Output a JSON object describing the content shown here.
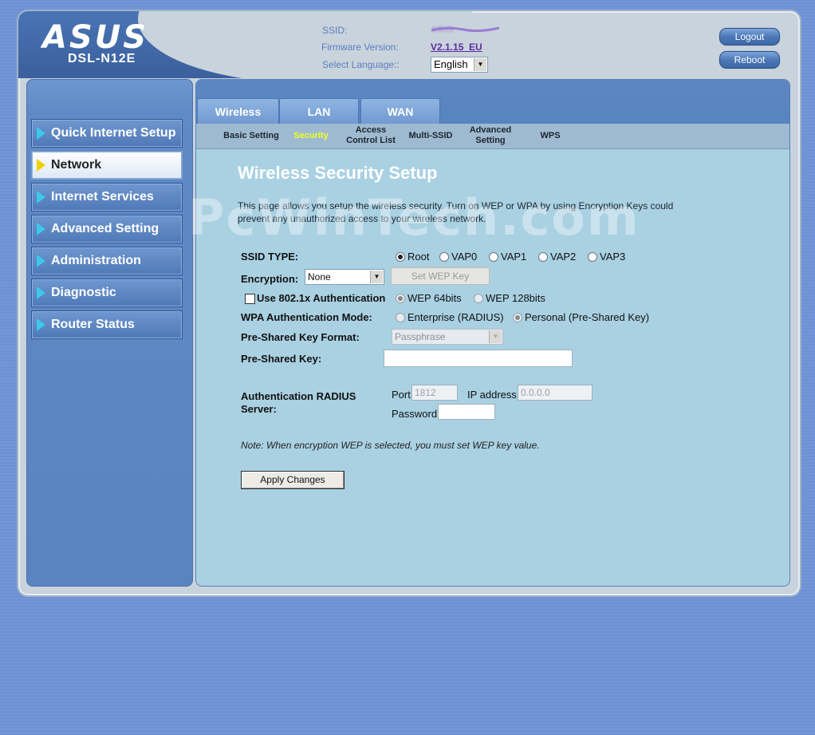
{
  "header": {
    "brand": "ASUS",
    "model": "DSL-N12E",
    "ssid_label": "SSID:",
    "ssid_value": "ASUS",
    "firmware_label": "Firmware Version:",
    "firmware_value": "V2.1.15_EU",
    "language_label": "Select Language::",
    "language_value": "English",
    "logout_label": "Logout",
    "reboot_label": "Reboot"
  },
  "sidebar": {
    "items": [
      {
        "label": "Quick Internet Setup",
        "active": false
      },
      {
        "label": "Network",
        "active": true
      },
      {
        "label": "Internet Services",
        "active": false
      },
      {
        "label": "Advanced Setting",
        "active": false
      },
      {
        "label": "Administration",
        "active": false
      },
      {
        "label": "Diagnostic",
        "active": false
      },
      {
        "label": "Router Status",
        "active": false
      }
    ]
  },
  "tabs": [
    {
      "label": "Wireless",
      "active": true
    },
    {
      "label": "LAN",
      "active": false
    },
    {
      "label": "WAN",
      "active": false
    }
  ],
  "subnav": [
    {
      "label": "Basic Setting",
      "active": false
    },
    {
      "label": "Security",
      "active": true
    },
    {
      "label": "Access Control List",
      "line1": "Access",
      "line2": "Control List",
      "active": false
    },
    {
      "label": "Multi-SSID",
      "active": false
    },
    {
      "label": "Advanced Setting",
      "line1": "Advanced",
      "line2": "Setting",
      "active": false
    },
    {
      "label": "WPS",
      "active": false
    }
  ],
  "watermark": "PcWinTech.com",
  "page": {
    "title": "Wireless Security Setup",
    "intro": "This page allows you setup the wireless security. Turn on WEP or WPA by using Encryption Keys could prevent any unauthorized access to your wireless network.",
    "ssid_type_label": "SSID TYPE:",
    "ssid_type_options": [
      "Root",
      "VAP0",
      "VAP1",
      "VAP2",
      "VAP3"
    ],
    "ssid_type_selected": "Root",
    "encryption_label": "Encryption:",
    "encryption_value": "None",
    "set_wep_key_label": "Set WEP Key",
    "use_8021x_label": "Use 802.1x Authentication",
    "use_8021x_checked": false,
    "wep_options": [
      "WEP 64bits",
      "WEP 128bits"
    ],
    "wep_selected": "WEP 64bits",
    "wpa_mode_label": "WPA Authentication Mode:",
    "wpa_mode_options": [
      "Enterprise (RADIUS)",
      "Personal (Pre-Shared Key)"
    ],
    "wpa_mode_selected": "Personal (Pre-Shared Key)",
    "psk_format_label": "Pre-Shared Key Format:",
    "psk_format_value": "Passphrase",
    "psk_label": "Pre-Shared Key:",
    "psk_value": "",
    "radius_label": "Authentication RADIUS Server:",
    "radius_label_line1": "Authentication RADIUS",
    "radius_label_line2": "Server:",
    "port_label": "Port",
    "port_value": "1812",
    "ip_label": "IP address",
    "ip_value": "0.0.0.0",
    "password_label": "Password",
    "password_value": "",
    "note": "Note: When encryption WEP is selected, you must set WEP key value.",
    "apply_label": "Apply Changes"
  }
}
